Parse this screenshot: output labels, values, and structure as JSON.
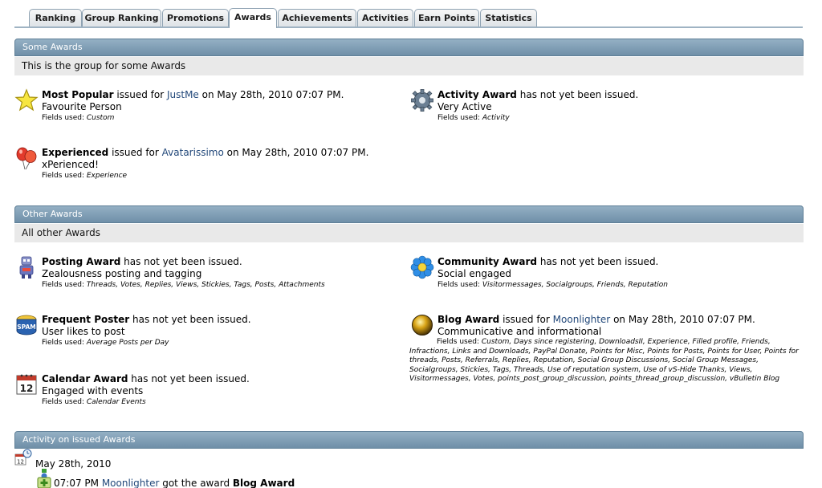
{
  "tabs": [
    "Ranking",
    "Group Ranking",
    "Promotions",
    "Awards",
    "Achievements",
    "Activities",
    "Earn Points",
    "Statistics"
  ],
  "sections": {
    "some": {
      "title": "Some Awards",
      "desc": "This is the group for some Awards"
    },
    "other": {
      "title": "Other Awards",
      "desc": "All other Awards"
    },
    "activity": {
      "title": "Activity on issued Awards"
    }
  },
  "fields_label": "Fields used:",
  "awards": {
    "most_popular": {
      "name": "Most Popular",
      "status": "issued for",
      "user": "JustMe",
      "date": "on May 28th, 2010 07:07 PM.",
      "desc": "Favourite Person",
      "fields": "Custom"
    },
    "activity": {
      "name": "Activity Award",
      "status": "has not yet been issued.",
      "desc": "Very Active",
      "fields": "Activity"
    },
    "experienced": {
      "name": "Experienced",
      "status": "issued for",
      "user": "Avatarissimo",
      "date": "on May 28th, 2010 07:07 PM.",
      "desc": "xPerienced!",
      "fields": "Experience"
    },
    "posting": {
      "name": "Posting Award",
      "status": "has not yet been issued.",
      "desc": "Zealousness posting and tagging",
      "fields": "Threads, Votes, Replies, Views, Stickies, Tags, Posts, Attachments"
    },
    "community": {
      "name": "Community Award",
      "status": "has not yet been issued.",
      "desc": "Social engaged",
      "fields": "Visitormessages, Socialgroups, Friends, Reputation"
    },
    "frequent": {
      "name": "Frequent Poster",
      "status": "has not yet been issued.",
      "desc": "User likes to post",
      "fields": "Average Posts per Day"
    },
    "blog": {
      "name": "Blog Award",
      "status": "issued for",
      "user": "Moonlighter",
      "date": "on May 28th, 2010 07:07 PM.",
      "desc": "Communicative and informational",
      "fields": "Custom, Days since registering, DownloadsII, Experience, Filled profile, Friends, Infractions, Links and Downloads, PayPal Donate, Points for Misc, Points for Posts, Points for User, Points for threads, Posts, Referrals, Replies, Reputation, Social Group Discussions, Social Group Messages, Socialgroups, Stickies, Tags, Threads, Use of reputation system, Use of vS-Hide Thanks, Views, Visitormessages, Votes, points_post_group_discussion, points_thread_group_discussion, vBulletin Blog"
    },
    "calendar": {
      "name": "Calendar Award",
      "status": "has not yet been issued.",
      "desc": "Engaged with events",
      "fields": "Calendar Events"
    }
  },
  "activity_log": {
    "date": "May 28th, 2010",
    "time": "07:07 PM",
    "user": "Moonlighter",
    "text": "got the award",
    "award": "Blog Award"
  },
  "colors": {
    "header": "#7d9ab0",
    "link": "#22487a",
    "desc_bg": "#e9e9e9"
  }
}
